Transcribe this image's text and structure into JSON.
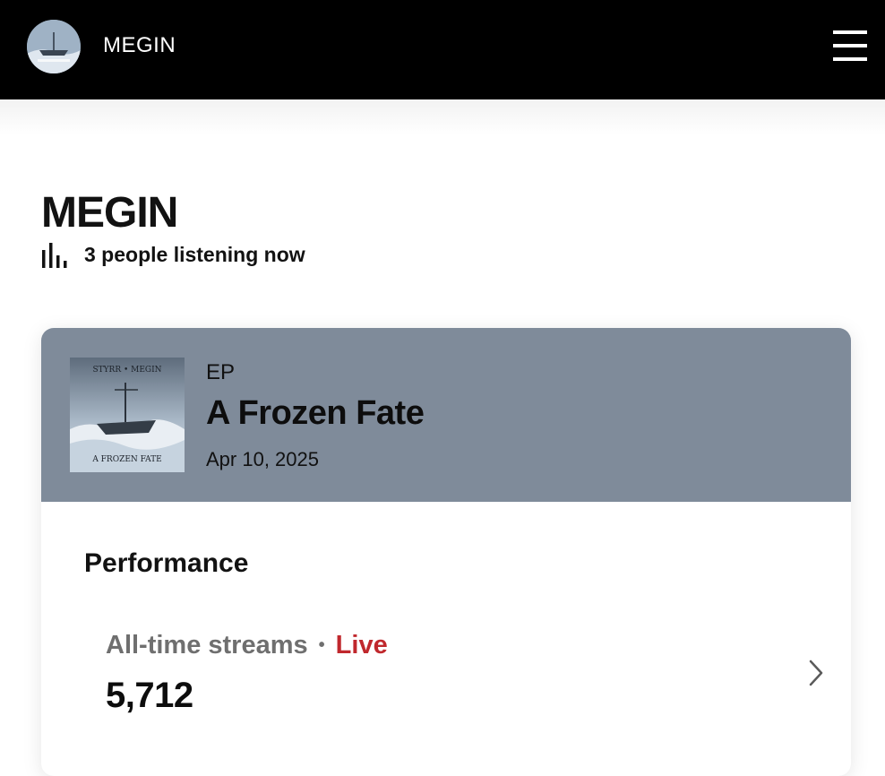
{
  "header": {
    "brand": "MEGIN",
    "avatar_icon": "band-avatar",
    "menu_icon": "hamburger-menu-icon"
  },
  "artist": {
    "name": "MEGIN",
    "listening_icon": "bar-chart-icon",
    "listening_text": "3 people listening now"
  },
  "release": {
    "type": "EP",
    "title": "A Frozen Fate",
    "date": "Apr 10, 2025",
    "cover_text_top": "STYRR • MEGIN",
    "cover_text_bottom": "A FROZEN FATE"
  },
  "performance": {
    "title": "Performance",
    "stat_label": "All-time streams",
    "separator": "•",
    "live_label": "Live",
    "stat_value": "5,712"
  },
  "colors": {
    "header_bg": "#000000",
    "card_head_bg": "#7f8b9a",
    "live": "#c0282d",
    "muted": "#6f6f6f"
  }
}
